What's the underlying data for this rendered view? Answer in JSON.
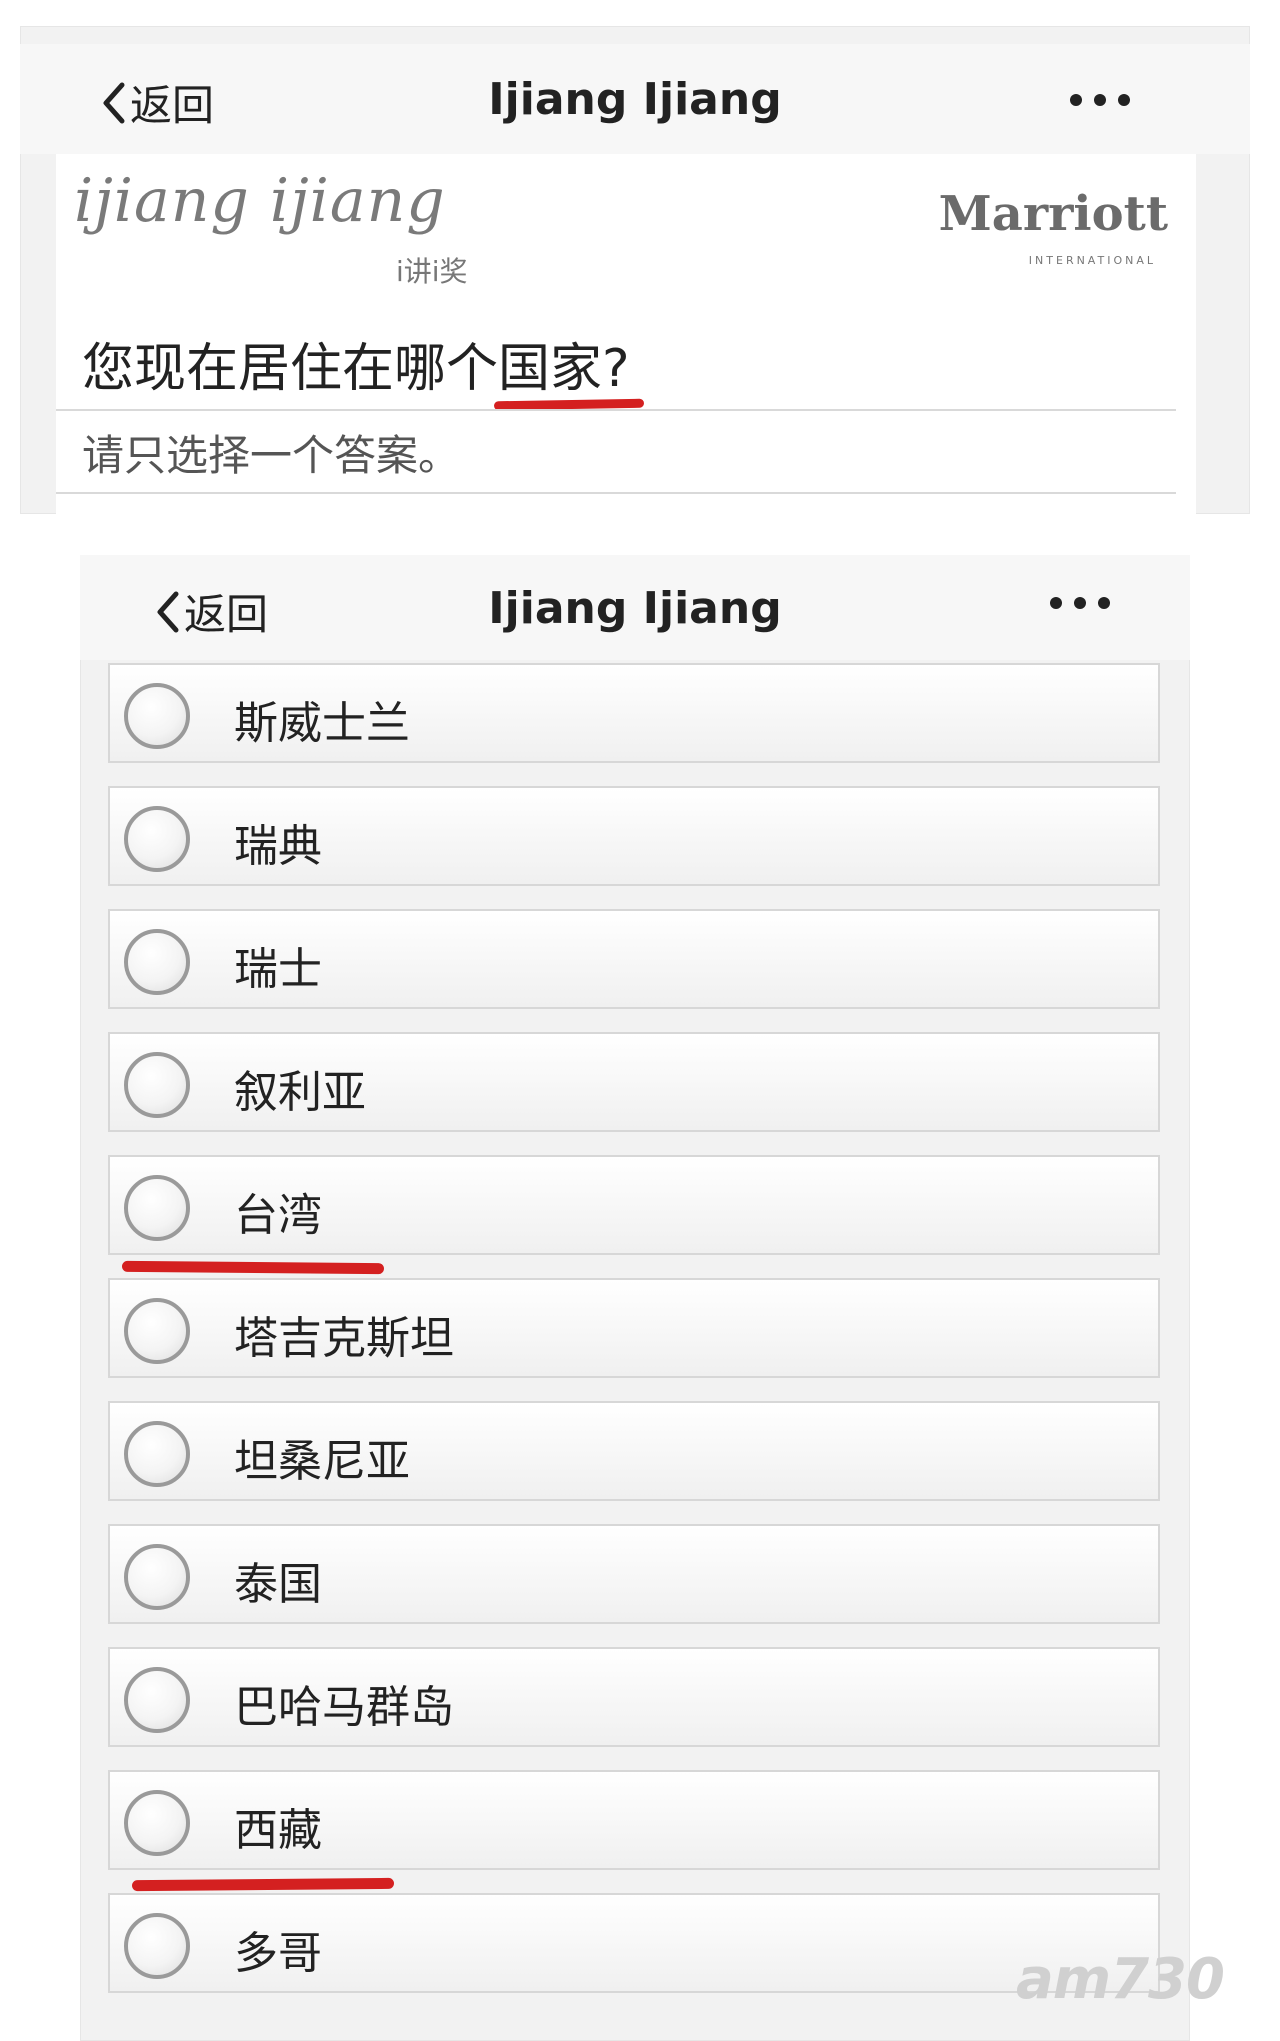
{
  "top_panel": {
    "nav": {
      "back_label": "返回",
      "title": "Ijiang Ijiang"
    },
    "brand": {
      "name": "ijiang ijiang",
      "subtitle": "i讲i奖"
    },
    "partner": {
      "name": "Marriott",
      "subtitle": "INTERNATIONAL"
    },
    "question": "您现在居住在哪个国家?",
    "hint": "请只选择一个答案。"
  },
  "bottom_panel": {
    "nav": {
      "back_label": "返回",
      "title": "Ijiang Ijiang"
    },
    "options": [
      {
        "label": "斯威士兰"
      },
      {
        "label": "瑞典"
      },
      {
        "label": "瑞士"
      },
      {
        "label": "叙利亚"
      },
      {
        "label": "台湾"
      },
      {
        "label": "塔吉克斯坦"
      },
      {
        "label": "坦桑尼亚"
      },
      {
        "label": "泰国"
      },
      {
        "label": "巴哈马群岛"
      },
      {
        "label": "西藏"
      },
      {
        "label": "多哥"
      }
    ]
  },
  "watermark": "am730",
  "colors": {
    "annotation_red": "#d42020",
    "panel_bg": "#f2f2f2"
  }
}
